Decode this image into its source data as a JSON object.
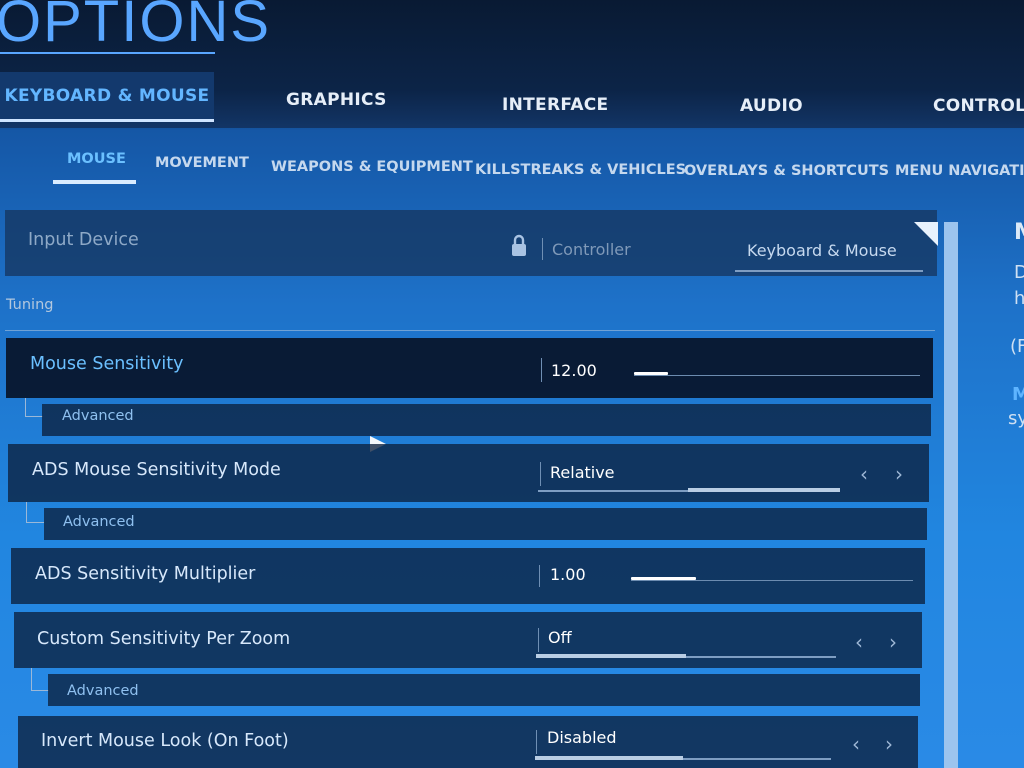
{
  "app": {
    "title": "OPTIONS"
  },
  "main_tabs": [
    {
      "label": "KEYBOARD & MOUSE",
      "active": true
    },
    {
      "label": "GRAPHICS"
    },
    {
      "label": "INTERFACE"
    },
    {
      "label": "AUDIO"
    },
    {
      "label": "CONTROLL"
    }
  ],
  "sub_tabs": [
    {
      "label": "MOUSE",
      "active": true
    },
    {
      "label": "MOVEMENT"
    },
    {
      "label": "WEAPONS & EQUIPMENT"
    },
    {
      "label": "KILLSTREAKS & VEHICLES"
    },
    {
      "label": "OVERLAYS & SHORTCUTS"
    },
    {
      "label": "MENU NAVIGATIO"
    }
  ],
  "input_device": {
    "label": "Input Device",
    "icon": "lock-icon",
    "option_controller": "Controller",
    "option_keyboard": "Keyboard & Mouse"
  },
  "section": {
    "label": "Tuning"
  },
  "settings": {
    "mouse_sensitivity": {
      "label": "Mouse Sensitivity",
      "value": "12.00",
      "fill_fraction": 0.12,
      "advanced": "Advanced"
    },
    "ads_mode": {
      "label": "ADS Mouse Sensitivity Mode",
      "value": "Relative",
      "advanced": "Advanced"
    },
    "ads_multiplier": {
      "label": "ADS Sensitivity Multiplier",
      "value": "1.00",
      "fill_fraction": 0.23
    },
    "custom_zoom": {
      "label": "Custom Sensitivity Per Zoom",
      "value": "Off",
      "advanced": "Advanced"
    },
    "invert_look": {
      "label": "Invert Mouse Look (On Foot)",
      "value": "Disabled"
    }
  },
  "right_panel": {
    "lines": [
      "M",
      "D",
      "h",
      "(F",
      "M",
      "sy"
    ]
  },
  "colors": {
    "accent": "#59a6ff",
    "panel": "#0c203e",
    "active_tab": "#13396d"
  }
}
